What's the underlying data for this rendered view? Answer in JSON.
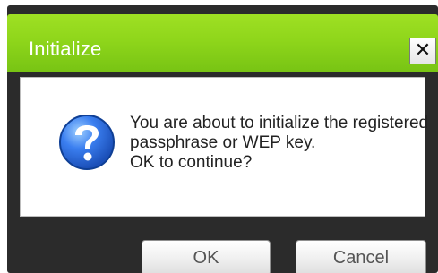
{
  "dialog": {
    "title": "Initialize",
    "close_label": "✕",
    "message_lines": [
      "You are about to initialize the registered",
      "passphrase or WEP key.",
      "OK to continue?"
    ],
    "icon": "question-icon",
    "buttons": {
      "ok_label": "OK",
      "cancel_label": "Cancel"
    },
    "colors": {
      "titlebar": "#8fd61b",
      "frame": "#2b2b2b",
      "question_icon": "#2f6ed8"
    }
  }
}
